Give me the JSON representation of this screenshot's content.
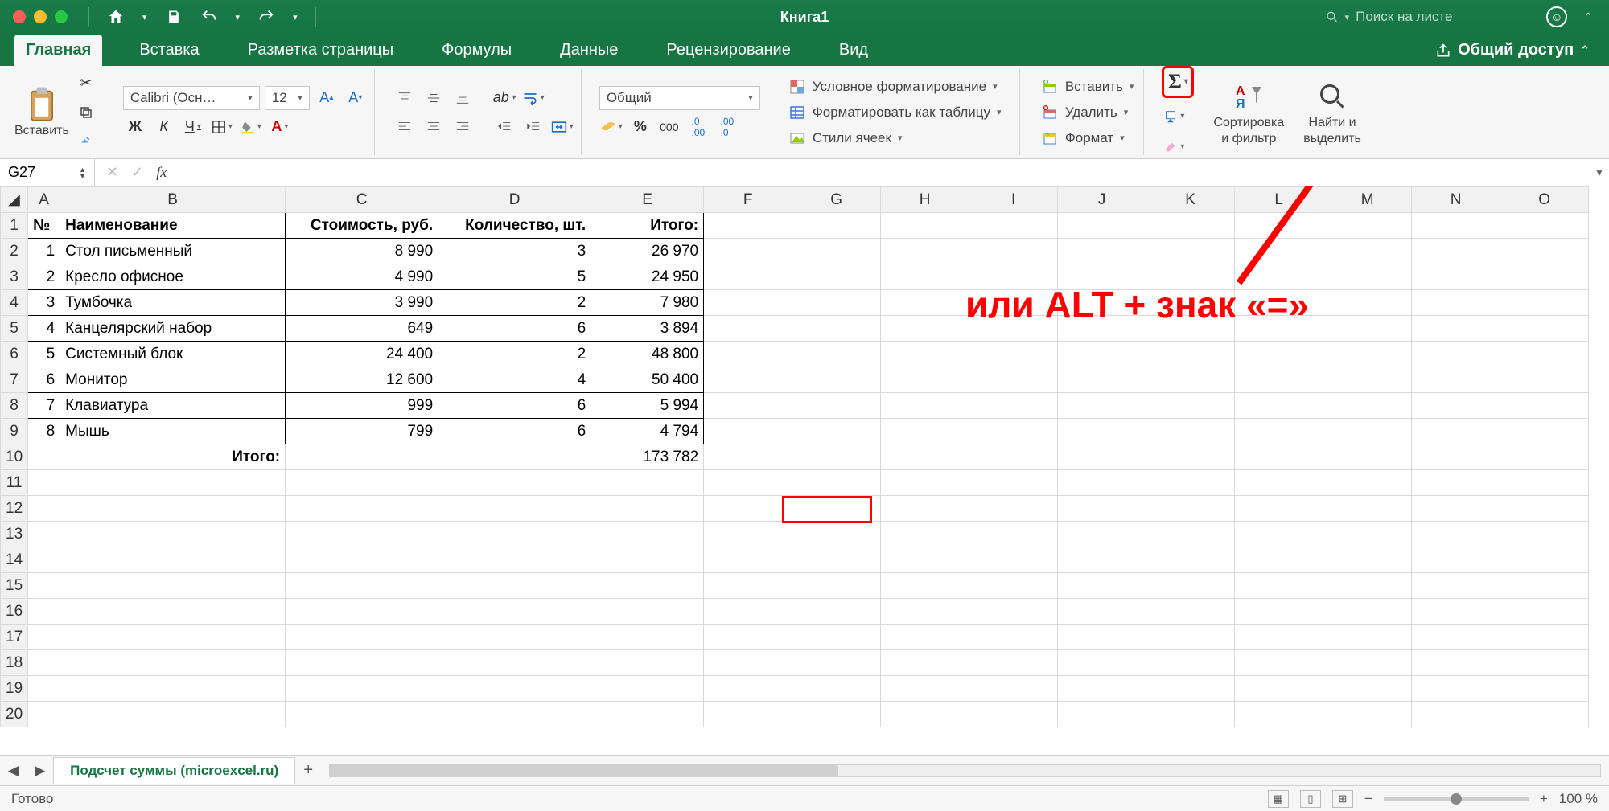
{
  "window": {
    "title": "Книга1"
  },
  "search": {
    "placeholder": "Поиск на листе"
  },
  "tabs": {
    "home": "Главная",
    "insert": "Вставка",
    "layout": "Разметка страницы",
    "formulas": "Формулы",
    "data": "Данные",
    "review": "Рецензирование",
    "view": "Вид",
    "share": "Общий доступ"
  },
  "ribbon": {
    "paste": "Вставить",
    "font_name": "Calibri (Осн…",
    "font_size": "12",
    "bold": "Ж",
    "italic": "К",
    "underline": "Ч",
    "number_format": "Общий",
    "cond_fmt": "Условное форматирование",
    "as_table": "Форматировать как таблицу",
    "cell_styles": "Стили ячеек",
    "insert_cells": "Вставить",
    "delete_cells": "Удалить",
    "format_cells": "Формат",
    "sort_filter1": "Сортировка",
    "sort_filter2": "и фильтр",
    "find1": "Найти и",
    "find2": "выделить"
  },
  "formula_bar": {
    "cell_ref": "G27",
    "formula": ""
  },
  "columns": [
    "A",
    "B",
    "C",
    "D",
    "E",
    "F",
    "G",
    "H",
    "I",
    "J",
    "K",
    "L",
    "M",
    "N",
    "O"
  ],
  "headers": {
    "no": "№",
    "name": "Наименование",
    "price": "Стоимость, руб.",
    "qty": "Количество, шт.",
    "total": "Итого:"
  },
  "rows": [
    {
      "n": "1",
      "name": "Стол письменный",
      "price": "8 990",
      "qty": "3",
      "total": "26 970"
    },
    {
      "n": "2",
      "name": "Кресло офисное",
      "price": "4 990",
      "qty": "5",
      "total": "24 950"
    },
    {
      "n": "3",
      "name": "Тумбочка",
      "price": "3 990",
      "qty": "2",
      "total": "7 980"
    },
    {
      "n": "4",
      "name": "Канцелярский набор",
      "price": "649",
      "qty": "6",
      "total": "3 894"
    },
    {
      "n": "5",
      "name": "Системный блок",
      "price": "24 400",
      "qty": "2",
      "total": "48 800"
    },
    {
      "n": "6",
      "name": "Монитор",
      "price": "12 600",
      "qty": "4",
      "total": "50 400"
    },
    {
      "n": "7",
      "name": "Клавиатура",
      "price": "999",
      "qty": "6",
      "total": "5 994"
    },
    {
      "n": "8",
      "name": "Мышь",
      "price": "799",
      "qty": "6",
      "total": "4 794"
    }
  ],
  "footer": {
    "label": "Итого:",
    "grand_total": "173 782"
  },
  "annotation": "или ALT + знак «=»",
  "sheet_tab": "Подсчет суммы (microexcel.ru)",
  "status": {
    "ready": "Готово",
    "zoom": "100 %"
  }
}
